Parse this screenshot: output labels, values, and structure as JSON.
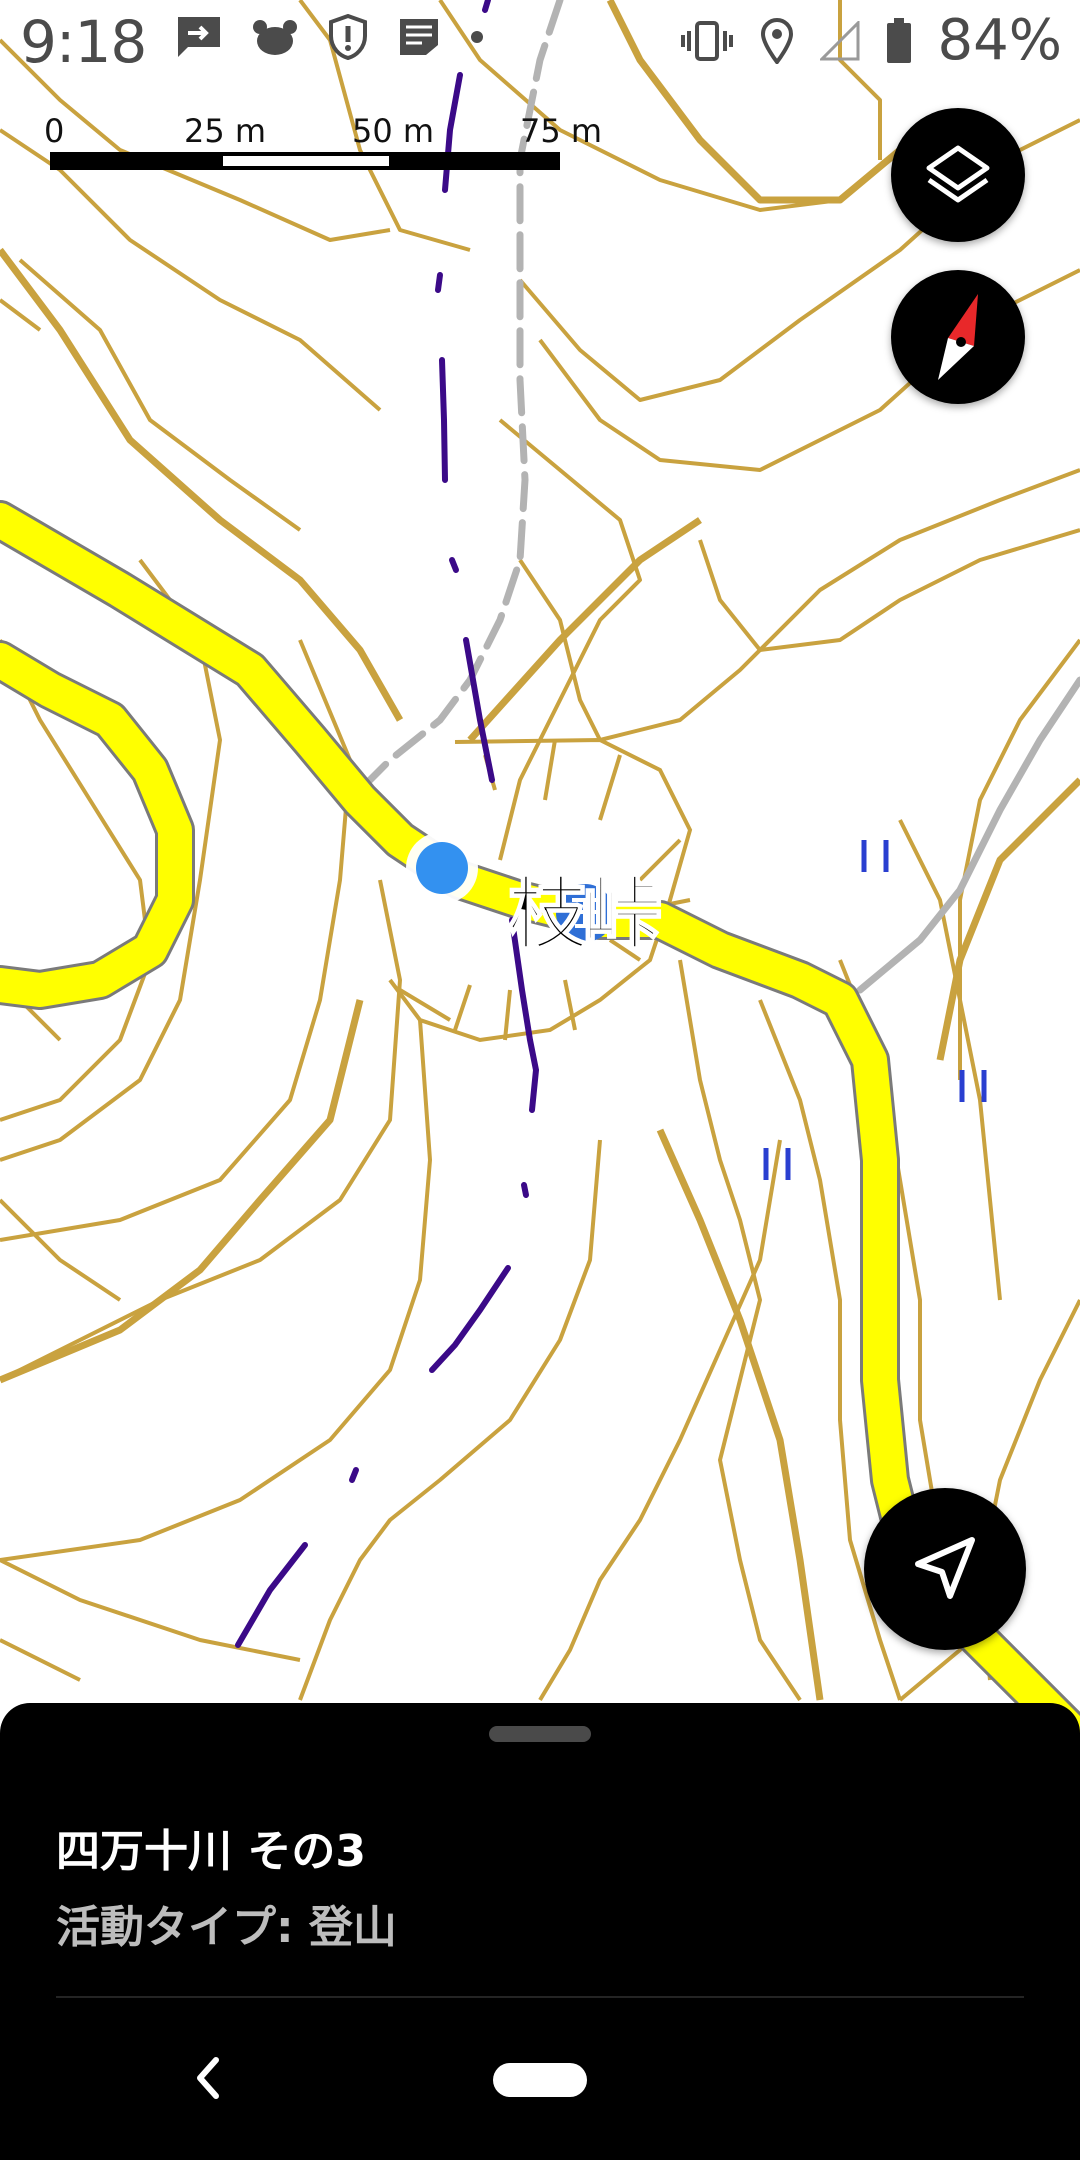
{
  "status_bar": {
    "time": "9:18",
    "battery_percent": "84%",
    "left_icons": [
      "message-icon",
      "animal-icon",
      "shield-alert-icon",
      "document-icon",
      "dot-icon"
    ],
    "right_icons": [
      "vibrate-icon",
      "location-icon",
      "signal-icon",
      "battery-icon"
    ]
  },
  "map": {
    "scale_labels": [
      "0",
      "25 m",
      "50 m",
      "75 m"
    ],
    "place_label": "枝峠",
    "colors": {
      "contour": "#c9a23f",
      "road_fill": "#ffff00",
      "road_edge": "#7a7a7a",
      "trail": "#3b0a88",
      "path_gray": "#b3b3b3",
      "location_dot": "#3391f0",
      "marker": "#2f6fd6",
      "marsh": "#2a3fd0"
    }
  },
  "controls": {
    "layers_button": "layers-icon",
    "compass_button": "compass-icon",
    "navigate_button": "navigation-arrow-icon"
  },
  "sheet": {
    "title": "四万十川 その3",
    "subtitle": "活動タイプ: 登山"
  },
  "system_nav": {
    "back": "back-chevron-icon",
    "home": "home-pill-icon"
  }
}
